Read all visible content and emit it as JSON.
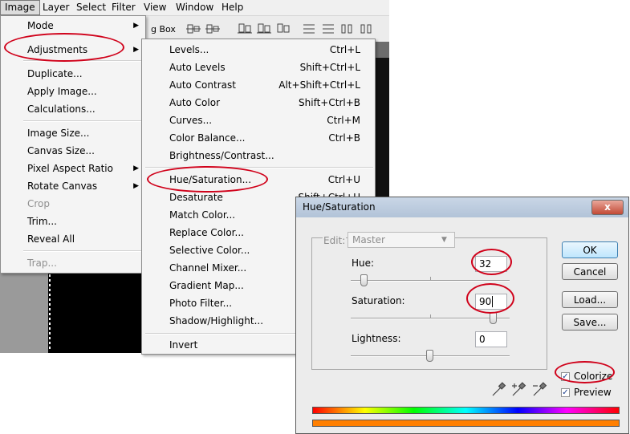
{
  "menubar": {
    "items": [
      "Image",
      "Layer",
      "Select",
      "Filter",
      "View",
      "Window",
      "Help"
    ]
  },
  "background": {
    "toolbar_label": "g Box"
  },
  "image_menu": {
    "items": [
      {
        "label": "Mode",
        "submenu": true
      },
      {
        "label": "Adjustments",
        "submenu": true
      },
      {
        "label": "Duplicate..."
      },
      {
        "label": "Apply Image..."
      },
      {
        "label": "Calculations..."
      },
      {
        "label": "Image Size..."
      },
      {
        "label": "Canvas Size..."
      },
      {
        "label": "Pixel Aspect Ratio",
        "submenu": true
      },
      {
        "label": "Rotate Canvas",
        "submenu": true
      },
      {
        "label": "Crop",
        "disabled": true
      },
      {
        "label": "Trim..."
      },
      {
        "label": "Reveal All"
      },
      {
        "label": "Trap...",
        "disabled": true
      }
    ]
  },
  "adjustments_menu": {
    "items": [
      {
        "label": "Levels...",
        "shortcut": "Ctrl+L"
      },
      {
        "label": "Auto Levels",
        "shortcut": "Shift+Ctrl+L"
      },
      {
        "label": "Auto Contrast",
        "shortcut": "Alt+Shift+Ctrl+L"
      },
      {
        "label": "Auto Color",
        "shortcut": "Shift+Ctrl+B"
      },
      {
        "label": "Curves...",
        "shortcut": "Ctrl+M"
      },
      {
        "label": "Color Balance...",
        "shortcut": "Ctrl+B"
      },
      {
        "label": "Brightness/Contrast...",
        "shortcut": ""
      },
      {
        "label": "Hue/Saturation...",
        "shortcut": "Ctrl+U"
      },
      {
        "label": "Desaturate",
        "shortcut": "Shift+Ctrl+U"
      },
      {
        "label": "Match Color...",
        "shortcut": ""
      },
      {
        "label": "Replace Color...",
        "shortcut": ""
      },
      {
        "label": "Selective Color...",
        "shortcut": ""
      },
      {
        "label": "Channel Mixer...",
        "shortcut": ""
      },
      {
        "label": "Gradient Map...",
        "shortcut": ""
      },
      {
        "label": "Photo Filter...",
        "shortcut": ""
      },
      {
        "label": "Shadow/Highlight...",
        "shortcut": ""
      },
      {
        "label": "Invert",
        "shortcut": ""
      }
    ]
  },
  "dialog": {
    "title": "Hue/Saturation",
    "close_glyph": "x",
    "edit_label": "Edit:",
    "edit_value": "Master",
    "hue_label": "Hue:",
    "hue_value": "32",
    "saturation_label": "Saturation:",
    "saturation_value": "90",
    "lightness_label": "Lightness:",
    "lightness_value": "0",
    "ok_label": "OK",
    "cancel_label": "Cancel",
    "load_label": "Load...",
    "save_label": "Save...",
    "colorize_label": "Colorize",
    "colorize_checked": true,
    "preview_label": "Preview",
    "preview_checked": true,
    "colors": {
      "result_bar": "#ff7f00",
      "annotation": "#d0021b"
    }
  }
}
